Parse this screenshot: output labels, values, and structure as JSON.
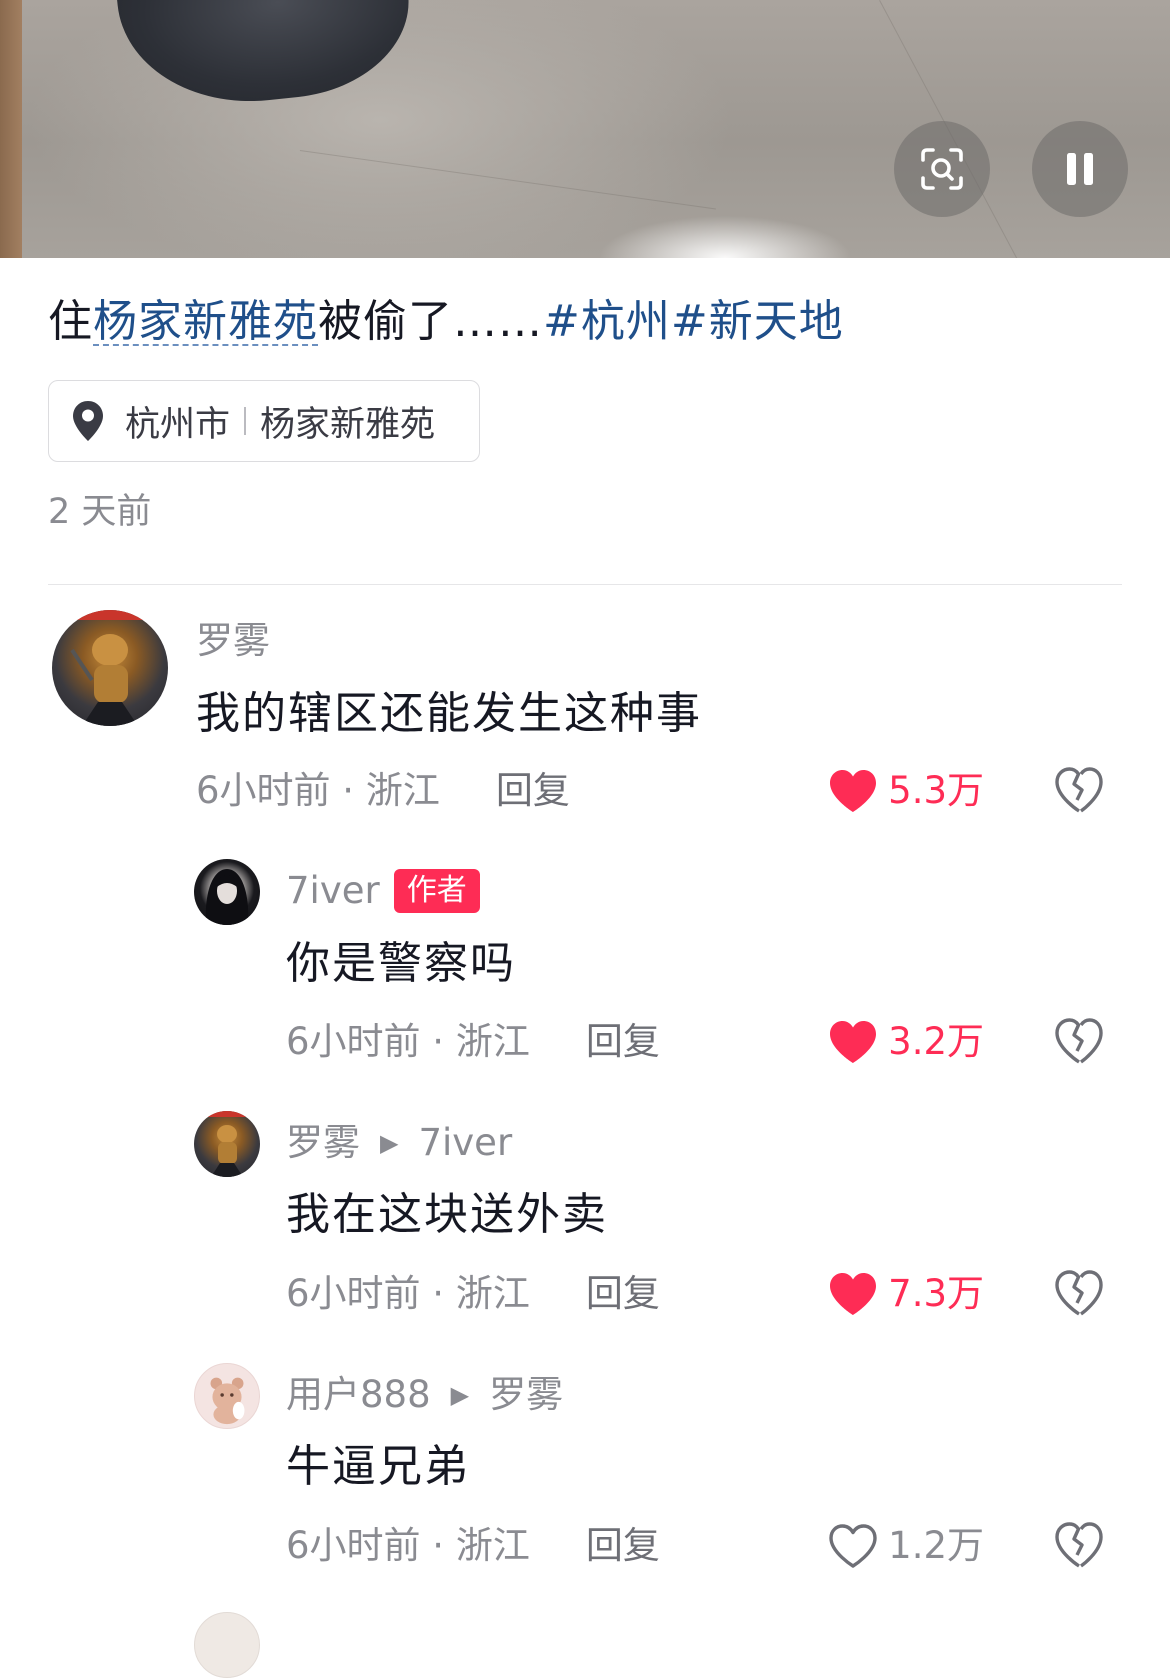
{
  "video": {
    "search_icon": "image-search-icon",
    "pause_icon": "pause-icon"
  },
  "post": {
    "title_prefix": "住",
    "title_link": "杨家新雅苑",
    "title_mid": "被偷了……",
    "tags": [
      "#杭州",
      "#新天地"
    ],
    "location_city": "杭州市",
    "location_place": "杨家新雅苑",
    "time": "2 天前"
  },
  "colors": {
    "accent": "#fe2c55",
    "link": "#1f4f8a",
    "muted": "#8a8b91"
  },
  "comments": [
    {
      "user": "罗雾",
      "text": "我的辖区还能发生这种事",
      "time": "6小时前 · 浙江",
      "reply_label": "回复",
      "likes": "5.3万",
      "liked": true
    },
    {
      "user": "7iver",
      "badge": "作者",
      "text": "你是警察吗",
      "time": "6小时前 · 浙江",
      "reply_label": "回复",
      "likes": "3.2万",
      "liked": true
    },
    {
      "user": "罗雾",
      "reply_to": "7iver",
      "text": "我在这块送外卖",
      "time": "6小时前 · 浙江",
      "reply_label": "回复",
      "likes": "7.3万",
      "liked": true
    },
    {
      "user": "用户888",
      "reply_to": "罗雾",
      "text": "牛逼兄弟",
      "time": "6小时前 · 浙江",
      "reply_label": "回复",
      "likes": "1.2万",
      "liked": false
    }
  ]
}
